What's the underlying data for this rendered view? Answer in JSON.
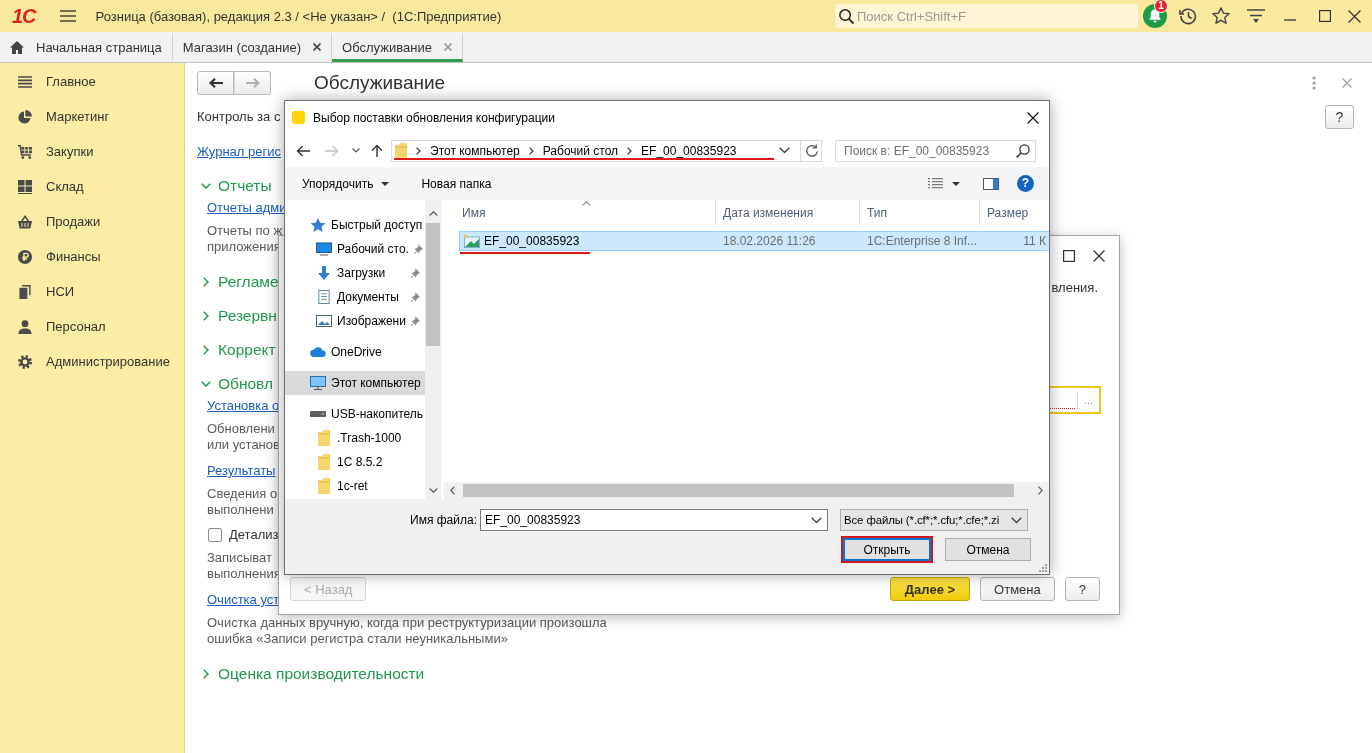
{
  "app_bar": {
    "logo": "1С",
    "title": "Розница (базовая), редакция 2.3 / <Не указан> /  (1С:Предприятие)",
    "search": {
      "placeholder": "Поиск Ctrl+Shift+F"
    },
    "notifications": {
      "count": "1"
    }
  },
  "tabs": [
    {
      "label": "Начальная страница",
      "kind": "home",
      "selected": false
    },
    {
      "label": "Магазин (создание)",
      "kind": "document",
      "selected": false
    },
    {
      "label": "Обслуживание",
      "kind": "document",
      "selected": true
    }
  ],
  "sidebar": {
    "items": [
      {
        "label": "Главное",
        "kind": "lines"
      },
      {
        "label": "Маркетинг",
        "kind": "pie"
      },
      {
        "label": "Закупки",
        "kind": "cart"
      },
      {
        "label": "Склад",
        "kind": "blocks"
      },
      {
        "label": "Продажи",
        "kind": "basket"
      },
      {
        "label": "Финансы",
        "kind": "ruble"
      },
      {
        "label": "НСИ",
        "kind": "stack"
      },
      {
        "label": "Персонал",
        "kind": "person"
      },
      {
        "label": "Администрирование",
        "kind": "gear"
      }
    ]
  },
  "page": {
    "history_buttons": [
      {
        "kind": "back",
        "disabled": false
      },
      {
        "kind": "forward",
        "disabled": true
      }
    ],
    "title": "Обслуживание",
    "help": "?",
    "intro": "Контроль за с",
    "log_link": "Журнал регис",
    "sections": [
      {
        "title": "Отчеты",
        "expanded": true,
        "items": [
          {
            "kind": "link",
            "text": "Отчеты адми"
          },
          {
            "kind": "note",
            "lines": [
              "Отчеты по ж",
              "приложения"
            ]
          }
        ]
      },
      {
        "title": "Регламе",
        "expanded": false
      },
      {
        "title": "Резервн",
        "expanded": false
      },
      {
        "title": "Коррект",
        "expanded": false
      },
      {
        "title": "Обновл",
        "expanded": true,
        "items": [
          {
            "kind": "link",
            "text": "Установка о"
          },
          {
            "kind": "note",
            "lines": [
              "Обновлени",
              "или установ"
            ]
          },
          {
            "kind": "link",
            "text": "Результаты"
          },
          {
            "kind": "note",
            "lines": [
              "Сведения о",
              "выполнени"
            ]
          },
          {
            "kind": "checkbox",
            "text": "Детализ",
            "checked": false
          },
          {
            "kind": "note",
            "lines": [
              "Записыват",
              "выполнения"
            ]
          },
          {
            "kind": "link",
            "text": "Очистка уст"
          },
          {
            "kind": "note",
            "lines": [
              "Очистка данных вручную, когда при реструктуризации произошла",
              "ошибка «Записи регистра стали неуникальными»"
            ]
          }
        ]
      },
      {
        "title": "Оценка производительности",
        "expanded": false
      }
    ]
  },
  "wizard": {
    "text": "вления.",
    "field": {
      "focused": true,
      "required": true,
      "choose_button": "..."
    },
    "back_button": {
      "label": "< Назад",
      "disabled": true
    },
    "buttons": [
      {
        "label": "Далее >",
        "kind": "primary"
      },
      {
        "label": "Отмена",
        "kind": "normal"
      },
      {
        "label": "?",
        "kind": "normal"
      }
    ]
  },
  "file_dialog": {
    "title": "Выбор поставки обновления конфигурации",
    "history_buttons": [
      {
        "kind": "back",
        "disabled": false
      },
      {
        "kind": "forward",
        "disabled": true
      }
    ],
    "address": {
      "path": [
        "Этот компьютер",
        "Рабочий стол",
        "EF_00_00835923"
      ],
      "marked": true
    },
    "search": {
      "placeholder": "Поиск в: EF_00_00835923"
    },
    "toolbar": {
      "organize": "Упорядочить",
      "new_folder": "Новая папка",
      "help": "?"
    },
    "nav": [
      {
        "label": "Быстрый доступ",
        "kind": "star",
        "selected": false,
        "pinned": false,
        "children": [
          {
            "label": "Рабочий сто.",
            "kind": "desktop",
            "selected": false,
            "pinned": true
          },
          {
            "label": "Загрузки",
            "kind": "downloads",
            "selected": false,
            "pinned": true
          },
          {
            "label": "Документы",
            "kind": "documents",
            "selected": false,
            "pinned": true
          },
          {
            "label": "Изображени",
            "kind": "pictures",
            "selected": false,
            "pinned": true
          }
        ]
      },
      {
        "label": "OneDrive",
        "kind": "cloud",
        "selected": false,
        "pinned": false
      },
      {
        "label": "Этот компьютер",
        "kind": "computer",
        "selected": true,
        "pinned": false
      },
      {
        "label": "USB-накопитель",
        "kind": "drive",
        "selected": false,
        "pinned": false,
        "children": [
          {
            "label": ".Trash-1000",
            "kind": "folder",
            "selected": false,
            "pinned": false
          },
          {
            "label": "1С 8.5.2",
            "kind": "folder",
            "selected": false,
            "pinned": false
          },
          {
            "label": "1c-ret",
            "kind": "folder",
            "selected": false,
            "pinned": false
          }
        ]
      }
    ],
    "columns": [
      {
        "label": "Имя",
        "sorted": true
      },
      {
        "label": "Дата изменения",
        "sorted": false
      },
      {
        "label": "Тип",
        "sorted": false
      },
      {
        "label": "Размер",
        "sorted": false
      }
    ],
    "files": [
      {
        "name": "EF_00_00835923",
        "modified": "18.02.2026 11:26",
        "type": "1C:Enterprise 8 Inf...",
        "size": "11 К",
        "selected": true,
        "marked": true
      }
    ],
    "file_name": {
      "label": "Имя файла:",
      "value": "EF_00_00835923"
    },
    "filter": "Все файлы (*.cf*;*.cfu;*.cfe;*.zi",
    "buttons": [
      {
        "label": "Открыть",
        "default": true,
        "marked": true
      },
      {
        "label": "Отмена",
        "default": false,
        "marked": false
      }
    ]
  }
}
